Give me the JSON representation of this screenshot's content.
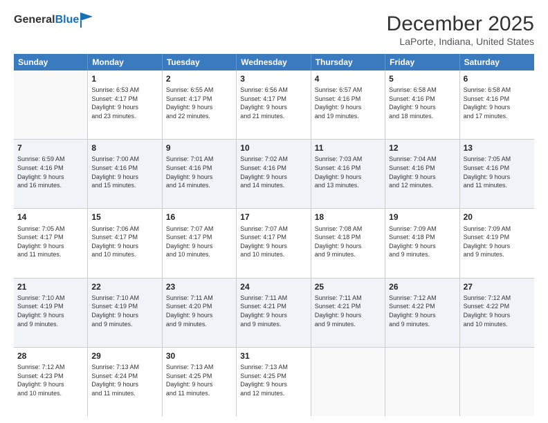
{
  "header": {
    "logo_general": "General",
    "logo_blue": "Blue",
    "month_title": "December 2025",
    "location": "LaPorte, Indiana, United States"
  },
  "days_of_week": [
    "Sunday",
    "Monday",
    "Tuesday",
    "Wednesday",
    "Thursday",
    "Friday",
    "Saturday"
  ],
  "weeks": [
    [
      {
        "day": "",
        "sunrise": "",
        "sunset": "",
        "daylight": "",
        "empty": true
      },
      {
        "day": "1",
        "sunrise": "Sunrise: 6:53 AM",
        "sunset": "Sunset: 4:17 PM",
        "daylight": "Daylight: 9 hours and 23 minutes."
      },
      {
        "day": "2",
        "sunrise": "Sunrise: 6:55 AM",
        "sunset": "Sunset: 4:17 PM",
        "daylight": "Daylight: 9 hours and 22 minutes."
      },
      {
        "day": "3",
        "sunrise": "Sunrise: 6:56 AM",
        "sunset": "Sunset: 4:17 PM",
        "daylight": "Daylight: 9 hours and 21 minutes."
      },
      {
        "day": "4",
        "sunrise": "Sunrise: 6:57 AM",
        "sunset": "Sunset: 4:16 PM",
        "daylight": "Daylight: 9 hours and 19 minutes."
      },
      {
        "day": "5",
        "sunrise": "Sunrise: 6:58 AM",
        "sunset": "Sunset: 4:16 PM",
        "daylight": "Daylight: 9 hours and 18 minutes."
      },
      {
        "day": "6",
        "sunrise": "Sunrise: 6:58 AM",
        "sunset": "Sunset: 4:16 PM",
        "daylight": "Daylight: 9 hours and 17 minutes."
      }
    ],
    [
      {
        "day": "7",
        "sunrise": "Sunrise: 6:59 AM",
        "sunset": "Sunset: 4:16 PM",
        "daylight": "Daylight: 9 hours and 16 minutes."
      },
      {
        "day": "8",
        "sunrise": "Sunrise: 7:00 AM",
        "sunset": "Sunset: 4:16 PM",
        "daylight": "Daylight: 9 hours and 15 minutes."
      },
      {
        "day": "9",
        "sunrise": "Sunrise: 7:01 AM",
        "sunset": "Sunset: 4:16 PM",
        "daylight": "Daylight: 9 hours and 14 minutes."
      },
      {
        "day": "10",
        "sunrise": "Sunrise: 7:02 AM",
        "sunset": "Sunset: 4:16 PM",
        "daylight": "Daylight: 9 hours and 14 minutes."
      },
      {
        "day": "11",
        "sunrise": "Sunrise: 7:03 AM",
        "sunset": "Sunset: 4:16 PM",
        "daylight": "Daylight: 9 hours and 13 minutes."
      },
      {
        "day": "12",
        "sunrise": "Sunrise: 7:04 AM",
        "sunset": "Sunset: 4:16 PM",
        "daylight": "Daylight: 9 hours and 12 minutes."
      },
      {
        "day": "13",
        "sunrise": "Sunrise: 7:05 AM",
        "sunset": "Sunset: 4:16 PM",
        "daylight": "Daylight: 9 hours and 11 minutes."
      }
    ],
    [
      {
        "day": "14",
        "sunrise": "Sunrise: 7:05 AM",
        "sunset": "Sunset: 4:17 PM",
        "daylight": "Daylight: 9 hours and 11 minutes."
      },
      {
        "day": "15",
        "sunrise": "Sunrise: 7:06 AM",
        "sunset": "Sunset: 4:17 PM",
        "daylight": "Daylight: 9 hours and 10 minutes."
      },
      {
        "day": "16",
        "sunrise": "Sunrise: 7:07 AM",
        "sunset": "Sunset: 4:17 PM",
        "daylight": "Daylight: 9 hours and 10 minutes."
      },
      {
        "day": "17",
        "sunrise": "Sunrise: 7:07 AM",
        "sunset": "Sunset: 4:17 PM",
        "daylight": "Daylight: 9 hours and 10 minutes."
      },
      {
        "day": "18",
        "sunrise": "Sunrise: 7:08 AM",
        "sunset": "Sunset: 4:18 PM",
        "daylight": "Daylight: 9 hours and 9 minutes."
      },
      {
        "day": "19",
        "sunrise": "Sunrise: 7:09 AM",
        "sunset": "Sunset: 4:18 PM",
        "daylight": "Daylight: 9 hours and 9 minutes."
      },
      {
        "day": "20",
        "sunrise": "Sunrise: 7:09 AM",
        "sunset": "Sunset: 4:19 PM",
        "daylight": "Daylight: 9 hours and 9 minutes."
      }
    ],
    [
      {
        "day": "21",
        "sunrise": "Sunrise: 7:10 AM",
        "sunset": "Sunset: 4:19 PM",
        "daylight": "Daylight: 9 hours and 9 minutes."
      },
      {
        "day": "22",
        "sunrise": "Sunrise: 7:10 AM",
        "sunset": "Sunset: 4:19 PM",
        "daylight": "Daylight: 9 hours and 9 minutes."
      },
      {
        "day": "23",
        "sunrise": "Sunrise: 7:11 AM",
        "sunset": "Sunset: 4:20 PM",
        "daylight": "Daylight: 9 hours and 9 minutes."
      },
      {
        "day": "24",
        "sunrise": "Sunrise: 7:11 AM",
        "sunset": "Sunset: 4:21 PM",
        "daylight": "Daylight: 9 hours and 9 minutes."
      },
      {
        "day": "25",
        "sunrise": "Sunrise: 7:11 AM",
        "sunset": "Sunset: 4:21 PM",
        "daylight": "Daylight: 9 hours and 9 minutes."
      },
      {
        "day": "26",
        "sunrise": "Sunrise: 7:12 AM",
        "sunset": "Sunset: 4:22 PM",
        "daylight": "Daylight: 9 hours and 9 minutes."
      },
      {
        "day": "27",
        "sunrise": "Sunrise: 7:12 AM",
        "sunset": "Sunset: 4:22 PM",
        "daylight": "Daylight: 9 hours and 10 minutes."
      }
    ],
    [
      {
        "day": "28",
        "sunrise": "Sunrise: 7:12 AM",
        "sunset": "Sunset: 4:23 PM",
        "daylight": "Daylight: 9 hours and 10 minutes."
      },
      {
        "day": "29",
        "sunrise": "Sunrise: 7:13 AM",
        "sunset": "Sunset: 4:24 PM",
        "daylight": "Daylight: 9 hours and 11 minutes."
      },
      {
        "day": "30",
        "sunrise": "Sunrise: 7:13 AM",
        "sunset": "Sunset: 4:25 PM",
        "daylight": "Daylight: 9 hours and 11 minutes."
      },
      {
        "day": "31",
        "sunrise": "Sunrise: 7:13 AM",
        "sunset": "Sunset: 4:25 PM",
        "daylight": "Daylight: 9 hours and 12 minutes."
      },
      {
        "day": "",
        "sunrise": "",
        "sunset": "",
        "daylight": "",
        "empty": true
      },
      {
        "day": "",
        "sunrise": "",
        "sunset": "",
        "daylight": "",
        "empty": true
      },
      {
        "day": "",
        "sunrise": "",
        "sunset": "",
        "daylight": "",
        "empty": true
      }
    ]
  ]
}
